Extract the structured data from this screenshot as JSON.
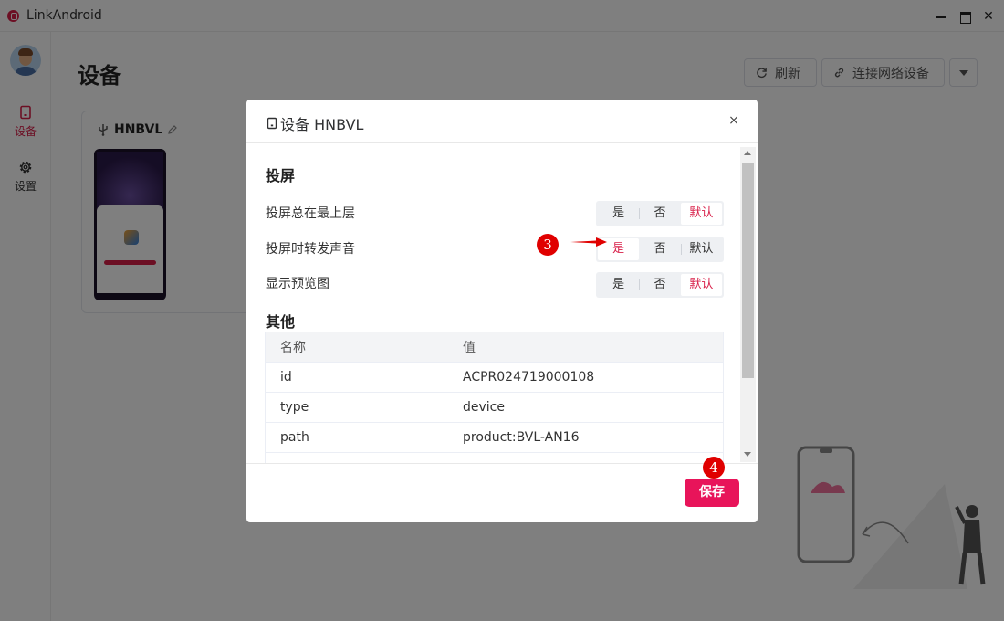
{
  "app": {
    "title": "LinkAndroid",
    "window_controls": {
      "minimize": "",
      "maximize": "",
      "close": "✕"
    }
  },
  "sidebar": {
    "items": [
      {
        "label": "设备",
        "icon": "device-icon",
        "active": true
      },
      {
        "label": "设置",
        "icon": "gear-icon",
        "active": false
      }
    ]
  },
  "main": {
    "title": "设备",
    "actions": {
      "refresh": "刷新",
      "connect": "连接网络设备"
    },
    "device_card": {
      "name": "HNBVL"
    }
  },
  "dialog": {
    "title": "设备 HNBVL",
    "close": "×",
    "sections": {
      "mirror": {
        "title": "投屏",
        "settings": [
          {
            "label": "投屏总在最上层",
            "options": [
              "是",
              "否",
              "默认"
            ],
            "selected": "默认"
          },
          {
            "label": "投屏时转发声音",
            "options": [
              "是",
              "否",
              "默认"
            ],
            "selected": "是"
          },
          {
            "label": "显示预览图",
            "options": [
              "是",
              "否",
              "默认"
            ],
            "selected": "默认"
          }
        ]
      },
      "other": {
        "title": "其他",
        "table": {
          "columns": [
            "名称",
            "值"
          ],
          "rows": [
            [
              "id",
              "ACPR024719000108"
            ],
            [
              "type",
              "device"
            ],
            [
              "path",
              "product:BVL-AN16"
            ]
          ]
        }
      }
    },
    "save_label": "保存"
  },
  "annotations": {
    "marker_3": "3",
    "marker_4": "4"
  },
  "colors": {
    "accent": "#e8145a",
    "marker": "#e00000",
    "selected_text": "#d81e48"
  }
}
